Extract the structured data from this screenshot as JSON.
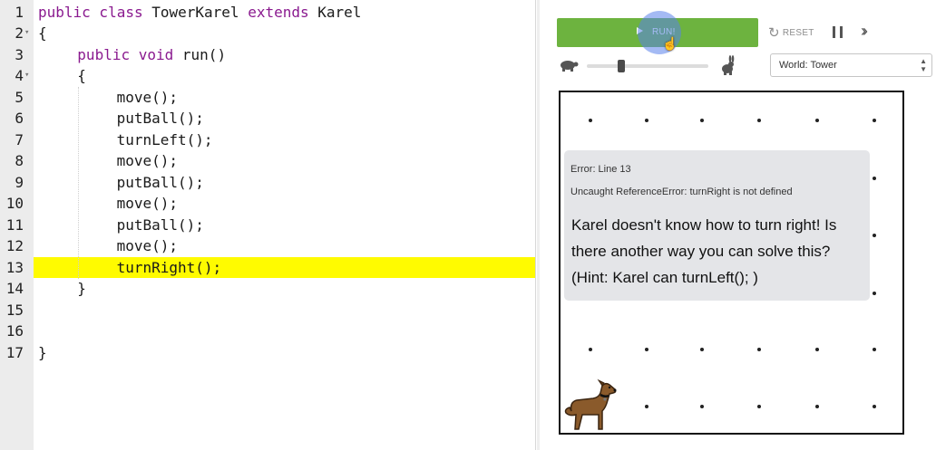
{
  "editor": {
    "lines": [
      {
        "n": "1",
        "indent": 0,
        "fold": false,
        "tokens": [
          {
            "t": "public class ",
            "k": true
          },
          {
            "t": "TowerKarel ",
            "k": false
          },
          {
            "t": "extends ",
            "k": true
          },
          {
            "t": "Karel",
            "k": false
          }
        ]
      },
      {
        "n": "2",
        "indent": 0,
        "fold": true,
        "tokens": [
          {
            "t": "{",
            "k": false
          }
        ]
      },
      {
        "n": "3",
        "indent": 1,
        "fold": false,
        "tokens": [
          {
            "t": "public ",
            "k": true
          },
          {
            "t": "void ",
            "k": true
          },
          {
            "t": "run()",
            "k": false
          }
        ]
      },
      {
        "n": "4",
        "indent": 1,
        "fold": true,
        "tokens": [
          {
            "t": "{",
            "k": false
          }
        ]
      },
      {
        "n": "5",
        "indent": 2,
        "fold": false,
        "tokens": [
          {
            "t": "move();",
            "k": false
          }
        ]
      },
      {
        "n": "6",
        "indent": 2,
        "fold": false,
        "tokens": [
          {
            "t": "putBall();",
            "k": false
          }
        ]
      },
      {
        "n": "7",
        "indent": 2,
        "fold": false,
        "tokens": [
          {
            "t": "turnLeft();",
            "k": false
          }
        ]
      },
      {
        "n": "8",
        "indent": 2,
        "fold": false,
        "tokens": [
          {
            "t": "move();",
            "k": false
          }
        ]
      },
      {
        "n": "9",
        "indent": 2,
        "fold": false,
        "tokens": [
          {
            "t": "putBall();",
            "k": false
          }
        ]
      },
      {
        "n": "10",
        "indent": 2,
        "fold": false,
        "tokens": [
          {
            "t": "move();",
            "k": false
          }
        ]
      },
      {
        "n": "11",
        "indent": 2,
        "fold": false,
        "tokens": [
          {
            "t": "putBall();",
            "k": false
          }
        ]
      },
      {
        "n": "12",
        "indent": 2,
        "fold": false,
        "tokens": [
          {
            "t": "move();",
            "k": false
          }
        ]
      },
      {
        "n": "13",
        "indent": 2,
        "fold": false,
        "highlight": true,
        "tokens": [
          {
            "t": "turnRight();",
            "k": false
          }
        ]
      },
      {
        "n": "14",
        "indent": 1,
        "fold": false,
        "tokens": [
          {
            "t": "}",
            "k": false
          }
        ]
      },
      {
        "n": "15",
        "indent": 0,
        "fold": false,
        "tokens": []
      },
      {
        "n": "16",
        "indent": 0,
        "fold": false,
        "tokens": []
      },
      {
        "n": "17",
        "indent": 0,
        "fold": false,
        "tokens": [
          {
            "t": "}",
            "k": false
          }
        ]
      }
    ]
  },
  "toolbar": {
    "run_label": "RUN!",
    "reset_label": "RESET",
    "pause_icon": "pause-icon",
    "fast_forward_icon": "fast-forward-icon",
    "speed_fraction": 0.28
  },
  "world_select": {
    "value": "World: Tower"
  },
  "error": {
    "line": "Error: Line 13",
    "detail": "Uncaught ReferenceError: turnRight is not defined",
    "message": "Karel doesn't know how to turn right! Is there another way you can solve this? (Hint: Karel can turnLeft(); )"
  },
  "world": {
    "columns": 6,
    "rows": 6
  },
  "colors": {
    "keyword": "#8a1a8f",
    "highlight": "#fffb00",
    "run_button": "#6db33f",
    "error_box": "#e4e5e8"
  }
}
